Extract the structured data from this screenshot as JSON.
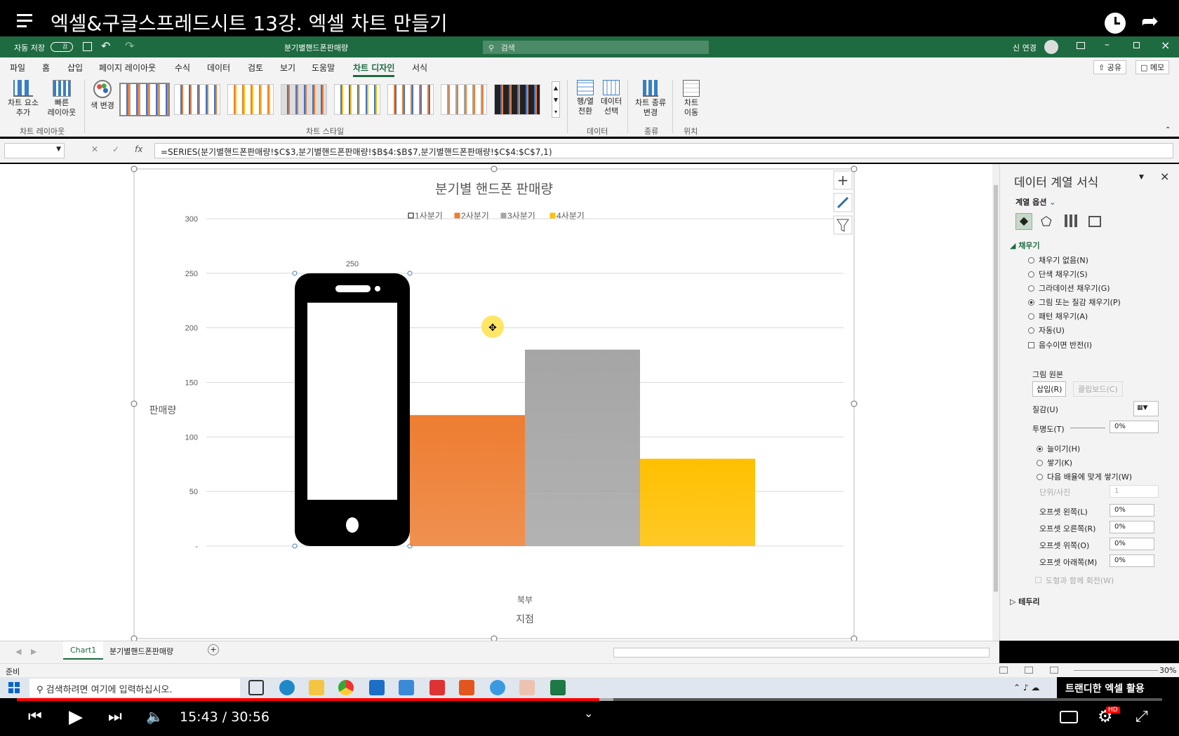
{
  "video": {
    "title": "엑셀&구글스프레드시트 13강. 엑셀 차트 만들기",
    "time": "15:43 / 30:56",
    "channel_caption": "트랜디한 엑셀 활용",
    "progress": 0.509
  },
  "excel": {
    "autosave_label": "자동 저장",
    "autosave_state": "끔",
    "file_name": "분기별핸드폰판매량",
    "search_placeholder": "검색",
    "user_name": "신 연경",
    "share_label": "공유",
    "memo_label": "메모"
  },
  "ribbon": {
    "tabs": [
      "파일",
      "홈",
      "삽입",
      "페이지 레이아웃",
      "수식",
      "데이터",
      "검토",
      "보기",
      "도움말",
      "차트 디자인",
      "서식"
    ],
    "active_tab": "차트 디자인",
    "add_element_label": "차트 요소\n추가",
    "quick_layout_label": "빠른\n레이아웃",
    "change_color_label": "색 변경",
    "switch_row_col_label": "행/열\n전환",
    "select_data_label": "데이터\n선택",
    "change_type_label": "차트 종류\n변경",
    "move_chart_label": "차트\n이동",
    "groups": [
      "차트 레이아웃",
      "차트 스타일",
      "데이터",
      "종류",
      "위치"
    ]
  },
  "formula_bar": {
    "name_box": "",
    "fx": "fx",
    "formula": "=SERIES(분기별핸드폰판매량!$C$3,분기별핸드폰판매량!$B$4:$B$7,분기별핸드폰판매량!$C$4:$C$7,1)"
  },
  "chart_data": {
    "type": "bar",
    "title": "분기별 핸드폰 판매량",
    "categories": [
      "북부"
    ],
    "series": [
      {
        "name": "1사분기",
        "values": [
          250
        ],
        "color": "#000000",
        "fill": "picture-phone"
      },
      {
        "name": "2사분기",
        "values": [
          120
        ],
        "color": "#ed7d31"
      },
      {
        "name": "3사분기",
        "values": [
          180
        ],
        "color": "#a5a5a5"
      },
      {
        "name": "4사분기",
        "values": [
          80
        ],
        "color": "#ffc000"
      }
    ],
    "data_labels": [
      {
        "series": "1사분기",
        "text": "250"
      }
    ],
    "ylabel": "판매량",
    "xlabel": "지점",
    "ylim": [
      0,
      300
    ],
    "yticks": [
      "-",
      "50",
      "100",
      "150",
      "200",
      "250",
      "300"
    ],
    "ytick_values": [
      0,
      50,
      100,
      150,
      200,
      250,
      300
    ],
    "grid": true,
    "legend": "top"
  },
  "pane": {
    "title": "데이터 계열 서식",
    "options_label": "계열 옵션",
    "fill_section": "채우기",
    "fill_options": [
      "채우기 없음(N)",
      "단색 채우기(S)",
      "그라데이션 채우기(G)",
      "그림 또는 질감 채우기(P)",
      "패턴 채우기(A)",
      "자동(U)"
    ],
    "selected_fill": 3,
    "invert_label": "음수이면 반전(I)",
    "picture_source": "그림 원본",
    "insert_label": "삽입(R)",
    "clipboard_label": "클립보드(C)",
    "texture_label": "질감(U)",
    "transparency_label": "투명도(T)",
    "transparency_value": "0%",
    "stretch_label": "늘이기(H)",
    "stack_label": "쌓기(K)",
    "stack_scale_label": "다음 배율에 맞게 쌓기(W)",
    "unit_label": "단위/사진",
    "unit_value": "1",
    "offsets": [
      {
        "label": "오프셋 왼쪽(L)",
        "value": "0%"
      },
      {
        "label": "오프셋 오른쪽(R)",
        "value": "0%"
      },
      {
        "label": "오프셋 위쪽(O)",
        "value": "0%"
      },
      {
        "label": "오프셋 아래쪽(M)",
        "value": "0%"
      }
    ],
    "rotate_label": "도형과 함께 회전(W)",
    "border_section": "테두리"
  },
  "sheets": {
    "tabs": [
      "Chart1",
      "분기별핸드폰판매량"
    ],
    "status": "준비",
    "zoom": "30%"
  },
  "taskbar": {
    "search_placeholder": "검색하려면 여기에 입력하십시오."
  }
}
